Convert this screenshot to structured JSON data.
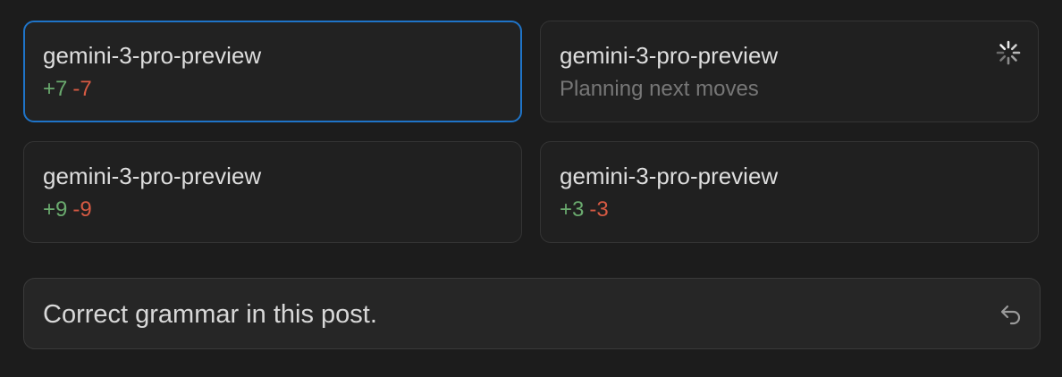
{
  "agents": [
    {
      "model": "gemini-3-pro-preview",
      "additions": "+7",
      "deletions": "-7",
      "selected": true
    },
    {
      "model": "gemini-3-pro-preview",
      "status": "Planning next moves",
      "loading": true
    },
    {
      "model": "gemini-3-pro-preview",
      "additions": "+9",
      "deletions": "-9"
    },
    {
      "model": "gemini-3-pro-preview",
      "additions": "+3",
      "deletions": "-3"
    }
  ],
  "prompt": {
    "text": "Correct grammar in this post."
  },
  "icons": {
    "spinner": "loading-spinner-icon",
    "undo": "undo-arrow-icon"
  },
  "colors": {
    "background": "#1c1c1c",
    "card": "#202020",
    "selected_border": "#1f74c8",
    "addition": "#6aaa6e",
    "deletion": "#d65a43",
    "muted_text": "#777777"
  }
}
